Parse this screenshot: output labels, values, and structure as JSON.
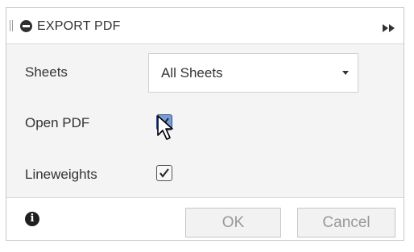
{
  "dialog": {
    "title": "EXPORT PDF",
    "collapse_icon": "minus-circle-icon",
    "expand_icon": "double-chevron-right-icon"
  },
  "fields": {
    "sheets": {
      "label": "Sheets",
      "value": "All Sheets"
    },
    "open_pdf": {
      "label": "Open PDF",
      "checked": true
    },
    "lineweights": {
      "label": "Lineweights",
      "checked": true
    }
  },
  "footer": {
    "info_icon": "info-icon",
    "ok_label": "OK",
    "cancel_label": "Cancel"
  },
  "colors": {
    "checkbox_hover": "#7f9cd2",
    "panel_background": "#f4f4f4",
    "disabled_text": "#999999"
  }
}
